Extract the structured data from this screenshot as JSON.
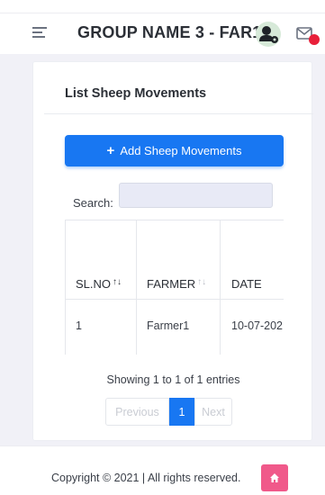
{
  "header": {
    "title": "GROUP NAME 3 -  FAR1",
    "menu_icon": "hamburger-menu-icon",
    "avatar_icon": "user-settings-icon",
    "mail_icon": "mail-notification-icon"
  },
  "card": {
    "title": "List Sheep Movements",
    "add_button_label": "Add Sheep Movements",
    "add_button_icon": "plus-icon"
  },
  "search": {
    "label": "Search:",
    "value": ""
  },
  "table": {
    "headers": [
      "SL.NO",
      "FARMER",
      "DATE"
    ],
    "rows": [
      [
        "1",
        "Farmer1",
        "10-07-202"
      ]
    ]
  },
  "pagination": {
    "info": "Showing 1 to 1 of 1 entries",
    "previous": "Previous",
    "current": "1",
    "next": "Next"
  },
  "footer": {
    "copyright": "Copyright © 2021 | All rights reserved.",
    "home_icon": "home-icon"
  },
  "colors": {
    "primary": "#1877f2",
    "accent_pink": "#f0598a",
    "background": "#f1f1f7",
    "notification_red": "#e8203a"
  }
}
